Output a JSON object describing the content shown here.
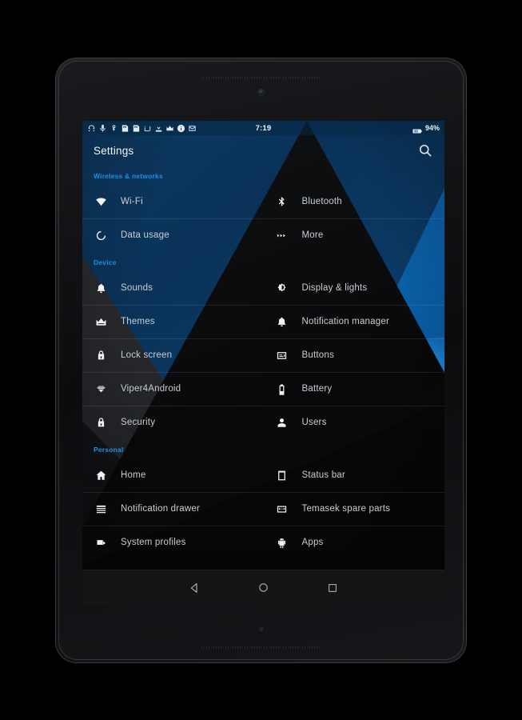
{
  "device": {
    "frame_name": "tablet"
  },
  "statusbar": {
    "clock": "7:19",
    "battery_percent": "94%",
    "icons": [
      "headphones-icon",
      "microphone-icon",
      "key-icon",
      "sd-card-icon",
      "sd-card-icon-2",
      "screenshot-icon",
      "download-icon",
      "crown-icon",
      "info-circle-icon",
      "mail-icon"
    ],
    "battery_icon": "battery-charging-icon"
  },
  "actionbar": {
    "title": "Settings",
    "search_icon": "search-icon"
  },
  "colors": {
    "accent": "#1e90e8",
    "label": "#c9ced4",
    "title": "#f2f5f8"
  },
  "sections": [
    {
      "header": "Wireless & networks",
      "rows": [
        [
          {
            "label": "Wi-Fi",
            "icon": "wifi-icon"
          },
          {
            "label": "Bluetooth",
            "icon": "bluetooth-icon"
          }
        ],
        [
          {
            "label": "Data usage",
            "icon": "data-usage-icon"
          },
          {
            "label": "More",
            "icon": "more-icon"
          }
        ]
      ]
    },
    {
      "header": "Device",
      "rows": [
        [
          {
            "label": "Sounds",
            "icon": "bell-icon"
          },
          {
            "label": "Display & lights",
            "icon": "brightness-icon"
          }
        ],
        [
          {
            "label": "Themes",
            "icon": "crown-icon"
          },
          {
            "label": "Notification manager",
            "icon": "bell-icon"
          }
        ],
        [
          {
            "label": "Lock screen",
            "icon": "lock-icon"
          },
          {
            "label": "Buttons",
            "icon": "buttons-icon"
          }
        ],
        [
          {
            "label": "Viper4Android",
            "icon": "viper-icon"
          },
          {
            "label": "Battery",
            "icon": "battery-icon"
          }
        ],
        [
          {
            "label": "Security",
            "icon": "lock-icon"
          },
          {
            "label": "Users",
            "icon": "user-icon"
          }
        ]
      ]
    },
    {
      "header": "Personal",
      "rows": [
        [
          {
            "label": "Home",
            "icon": "home-icon"
          },
          {
            "label": "Status bar",
            "icon": "status-bar-icon"
          }
        ],
        [
          {
            "label": "Notification drawer",
            "icon": "notification-drawer-icon"
          },
          {
            "label": "Temasek spare parts",
            "icon": "spare-parts-icon"
          }
        ],
        [
          {
            "label": "System profiles",
            "icon": "system-profiles-icon"
          },
          {
            "label": "Apps",
            "icon": "android-icon"
          }
        ]
      ]
    }
  ],
  "navbar": {
    "back": "back-icon",
    "home": "home-circle-icon",
    "recents": "recents-icon"
  }
}
